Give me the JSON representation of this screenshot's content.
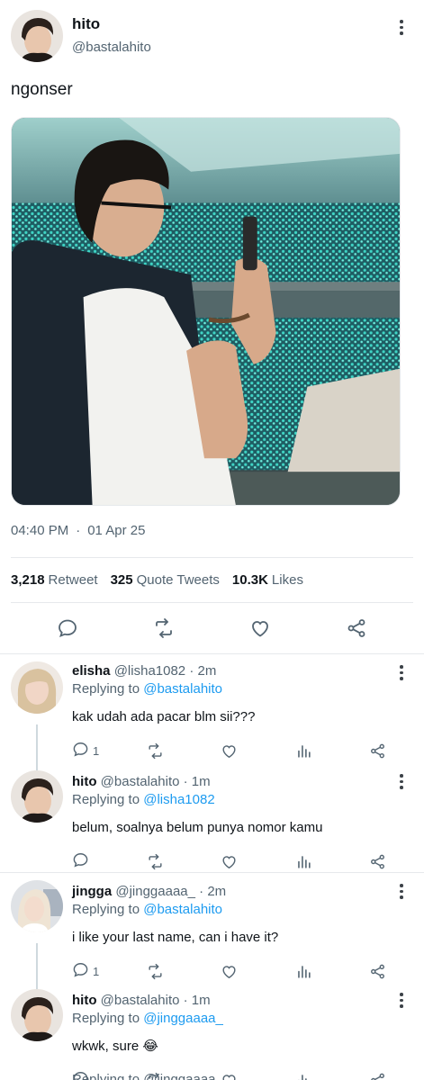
{
  "main_tweet": {
    "display_name": "hito",
    "handle": "@bastalahito",
    "text": "ngonser",
    "time": "04:40 PM",
    "date_separator": "·",
    "date": "01 Apr 25",
    "stats": [
      {
        "count": "3,218",
        "label": "Retweet"
      },
      {
        "count": "325",
        "label": "Quote Tweets"
      },
      {
        "count": "10.3K",
        "label": "Likes"
      }
    ]
  },
  "replies": [
    {
      "name": "elisha",
      "handle": "@lisha1082",
      "sep": "·",
      "time": "2m",
      "replying_prefix": "Replying to",
      "replying_to": "@bastalahito",
      "text": "kak udah ada pacar blm sii???",
      "reply_count": "1"
    },
    {
      "name": "hito",
      "handle": "@bastalahito",
      "sep": "·",
      "time": "1m",
      "replying_prefix": "Replying to",
      "replying_to": "@lisha1082",
      "text": "belum, soalnya belum punya nomor kamu",
      "reply_count": ""
    },
    {
      "name": "jingga",
      "handle": "@jinggaaaa_",
      "sep": "·",
      "time": "2m",
      "replying_prefix": "Replying to",
      "replying_to": "@bastalahito",
      "text": "i like your last name, can i have it?",
      "reply_count": "1"
    },
    {
      "name": "hito",
      "handle": "@bastalahito",
      "sep": "·",
      "time": "1m",
      "replying_prefix": "Replying to",
      "replying_to": "@jinggaaaa_",
      "text": "wkwk, sure 😂",
      "reply_count": ""
    }
  ],
  "cut_off_text": "Replying to @jinggaaaa_",
  "colors": {
    "link": "#1d9bf0",
    "secondary_text": "#536471",
    "divider": "#e6e9ec",
    "stadium_lights": "#3fd6c6"
  },
  "icons": [
    "more-vertical-icon",
    "comment-icon",
    "retweet-icon",
    "heart-icon",
    "share-icon",
    "views-icon"
  ]
}
